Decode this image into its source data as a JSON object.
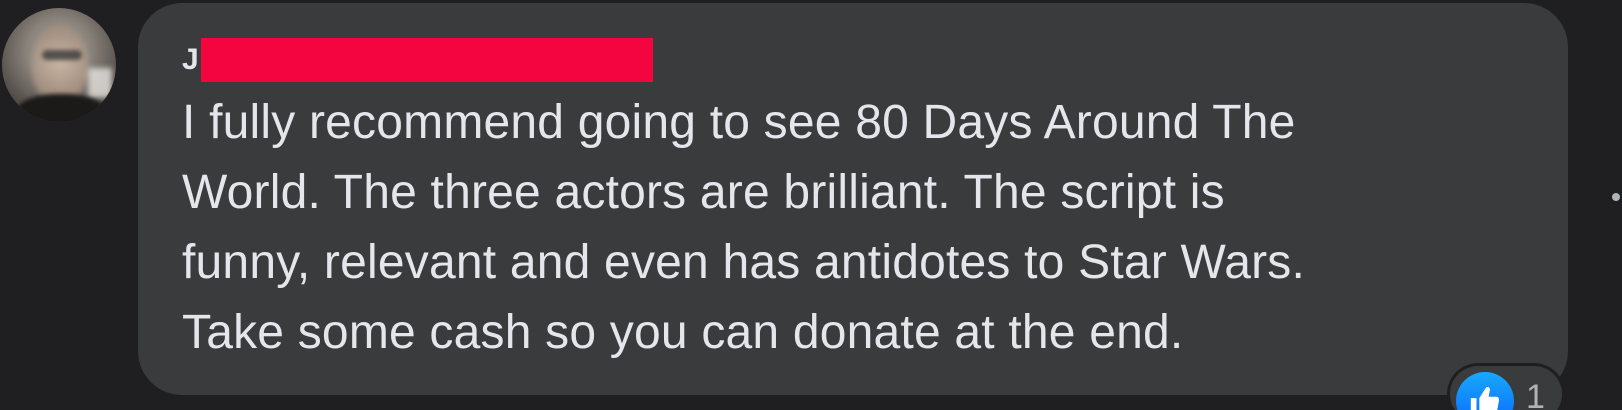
{
  "comment": {
    "author_initial": "J",
    "lines": [
      "I fully recommend going to see 80 Days Around The",
      "World. The three actors are brilliant. The script is",
      "funny, relevant and even has antidotes to Star Wars.",
      "Take some cash so you can donate at the end."
    ]
  },
  "reactions": {
    "icon": "thumbs-up-icon",
    "count": "1"
  },
  "colors": {
    "background": "#1f1f21",
    "bubble": "#3a3b3d",
    "text": "#e4e6eb",
    "redaction": "#f5053f",
    "like_blue": "#0866ff"
  }
}
